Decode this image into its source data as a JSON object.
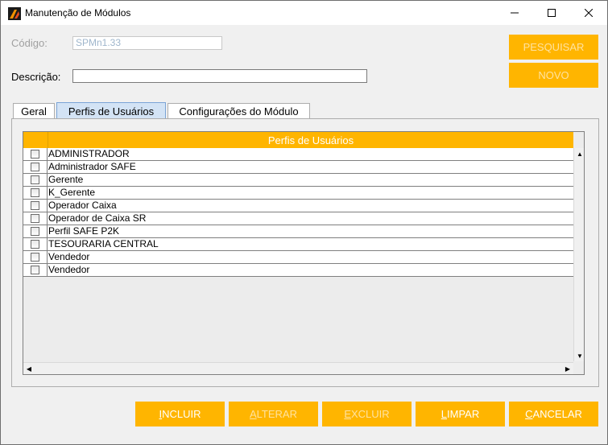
{
  "window": {
    "title": "Manutenção de Módulos",
    "minimize_glyph": "—",
    "maximize_glyph": "☐",
    "close_glyph": "✕"
  },
  "form": {
    "codigo_label": "Código:",
    "codigo_value": "SPMn1.33",
    "descricao_label": "Descrição:",
    "descricao_value": ""
  },
  "side_buttons": {
    "pesquisar": "PESQUISAR",
    "novo": "NOVO"
  },
  "tabs": [
    {
      "label": "Geral"
    },
    {
      "label": "Perfis de Usuários"
    },
    {
      "label": "Configurações do Módulo"
    }
  ],
  "grid": {
    "header": "Perfis de Usuários",
    "rows": [
      {
        "label": "ADMINISTRADOR",
        "checked": false
      },
      {
        "label": "Administrador SAFE",
        "checked": false
      },
      {
        "label": "Gerente",
        "checked": false
      },
      {
        "label": "K_Gerente",
        "checked": false
      },
      {
        "label": "Operador Caixa",
        "checked": false
      },
      {
        "label": "Operador de Caixa SR",
        "checked": false
      },
      {
        "label": "Perfil SAFE P2K",
        "checked": false
      },
      {
        "label": "TESOURARIA CENTRAL",
        "checked": false
      },
      {
        "label": "Vendedor",
        "checked": false
      },
      {
        "label": "Vendedor",
        "checked": false
      }
    ]
  },
  "footer_buttons": {
    "incluir": {
      "first": "I",
      "rest": "NCLUIR"
    },
    "alterar": {
      "first": "A",
      "rest": "LTERAR"
    },
    "excluir": {
      "first": "E",
      "rest": "XCLUIR"
    },
    "limpar": {
      "first": "L",
      "rest": "IMPAR"
    },
    "cancelar": {
      "first": "C",
      "rest": "ANCELAR"
    }
  },
  "colors": {
    "accent": "#ffb500",
    "active_tab": "#d3e3f5"
  }
}
